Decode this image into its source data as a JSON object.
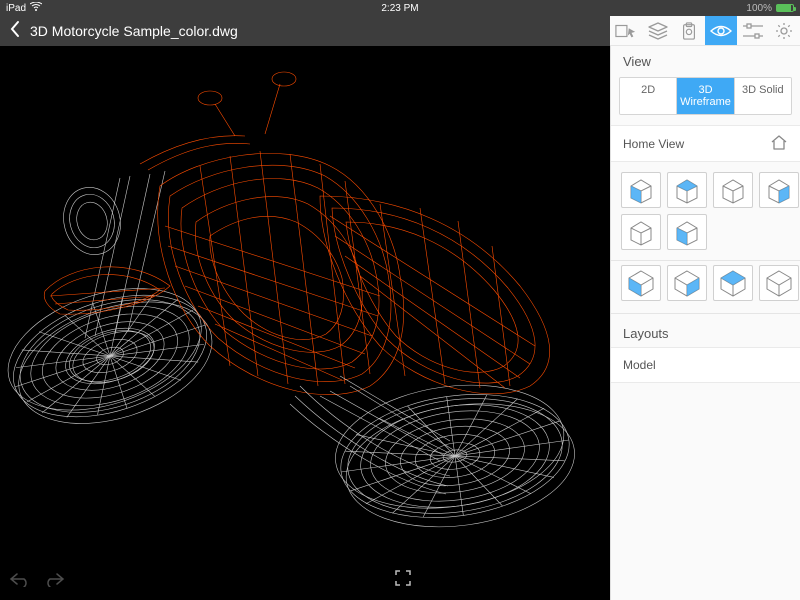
{
  "status": {
    "carrier": "iPad",
    "time": "2:23 PM",
    "battery_pct": "100%"
  },
  "titlebar": {
    "filename": "3D Motorcycle Sample_color.dwg"
  },
  "side": {
    "view_label": "View",
    "modes": {
      "m2d": "2D",
      "m3dw": "3D Wireframe",
      "m3ds": "3D Solid",
      "selected": "3D Wireframe"
    },
    "home_label": "Home View",
    "layouts_label": "Layouts",
    "layout_item": "Model"
  }
}
